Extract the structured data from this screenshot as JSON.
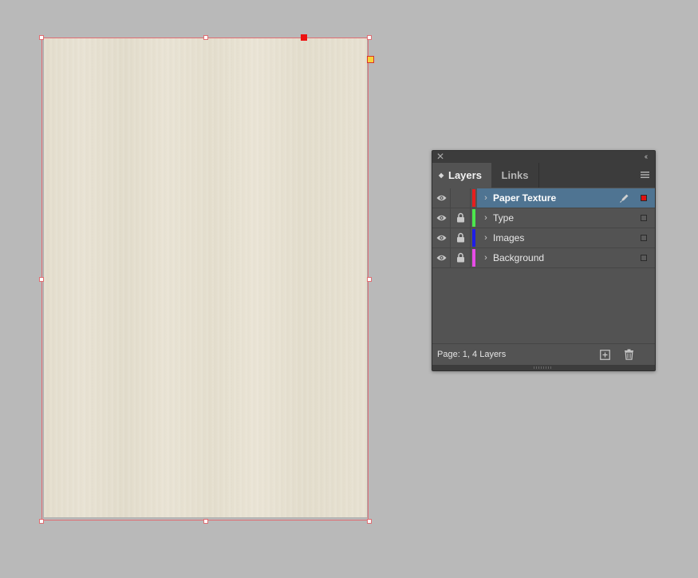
{
  "panel": {
    "tabs": [
      {
        "label": "Layers",
        "active": true
      },
      {
        "label": "Links",
        "active": false
      }
    ],
    "layers": [
      {
        "name": "Paper Texture",
        "color": "#e61e1e",
        "selected": true,
        "locked": false,
        "visible": true
      },
      {
        "name": "Type",
        "color": "#4ce64c",
        "selected": false,
        "locked": true,
        "visible": true
      },
      {
        "name": "Images",
        "color": "#1e1ee6",
        "selected": false,
        "locked": true,
        "visible": true
      },
      {
        "name": "Background",
        "color": "#e64ce6",
        "selected": false,
        "locked": true,
        "visible": true
      }
    ],
    "status": "Page: 1, 4 Layers",
    "icons": {
      "close": "close-icon",
      "collapse": "double-chevron-icon",
      "menu": "hamburger-menu-icon",
      "new_layer": "new-layer-icon",
      "delete": "trash-icon"
    }
  },
  "document": {
    "paper_color": "#e5dfcf",
    "frame_color": "#e06e73"
  }
}
